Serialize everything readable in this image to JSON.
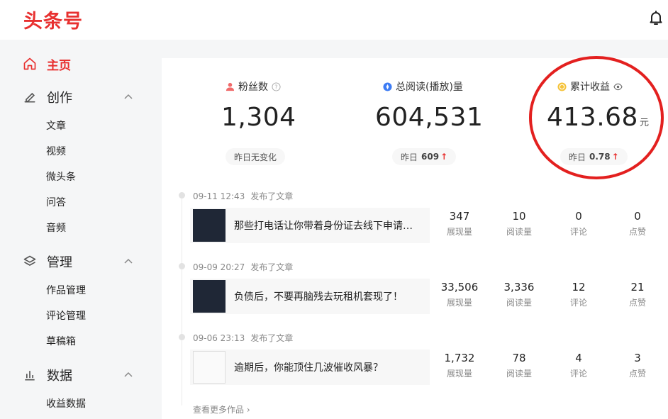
{
  "brand": {
    "logo": "头条号",
    "accent": "#e8302f"
  },
  "sidebar": {
    "home": "主页",
    "groups": [
      {
        "label": "创作",
        "items": [
          "文章",
          "视频",
          "微头条",
          "问答",
          "音频"
        ]
      },
      {
        "label": "管理",
        "items": [
          "作品管理",
          "评论管理",
          "草稿箱"
        ]
      },
      {
        "label": "数据",
        "items": [
          "收益数据"
        ]
      }
    ]
  },
  "stats": {
    "fans": {
      "label": "粉丝数",
      "value": "1,304",
      "note": "昨日无变化"
    },
    "reads": {
      "label": "总阅读(播放)量",
      "value": "604,531",
      "note_label": "昨日",
      "note_value": "609"
    },
    "income": {
      "label": "累计收益",
      "value": "413.68",
      "unit": "元",
      "note_label": "昨日",
      "note_value": "0.78"
    }
  },
  "timeline": {
    "entries": [
      {
        "time": "09-11 12:43",
        "action": "发布了文章",
        "title": "那些打电话让你带着身份证去线下申请…",
        "metrics": [
          {
            "value": "347",
            "label": "展现量"
          },
          {
            "value": "10",
            "label": "阅读量"
          },
          {
            "value": "0",
            "label": "评论"
          },
          {
            "value": "0",
            "label": "点赞"
          }
        ]
      },
      {
        "time": "09-09 20:27",
        "action": "发布了文章",
        "title": "负债后，不要再脑残去玩租机套现了！",
        "metrics": [
          {
            "value": "33,506",
            "label": "展现量"
          },
          {
            "value": "3,336",
            "label": "阅读量"
          },
          {
            "value": "12",
            "label": "评论"
          },
          {
            "value": "21",
            "label": "点赞"
          }
        ]
      },
      {
        "time": "09-06 23:13",
        "action": "发布了文章",
        "title": "逾期后，你能顶住几波催收风暴？",
        "metrics": [
          {
            "value": "1,732",
            "label": "展现量"
          },
          {
            "value": "78",
            "label": "阅读量"
          },
          {
            "value": "4",
            "label": "评论"
          },
          {
            "value": "3",
            "label": "点赞"
          }
        ]
      }
    ],
    "more": "查看更多作品 ›"
  },
  "icons": {
    "bell": "bell-icon",
    "home": "home-icon",
    "create": "pen-icon",
    "manage": "layers-icon",
    "data": "bar-chart-icon",
    "fans": "user-icon",
    "reads": "read-icon",
    "income": "coin-icon",
    "help": "help-icon",
    "eye": "eye-icon"
  }
}
